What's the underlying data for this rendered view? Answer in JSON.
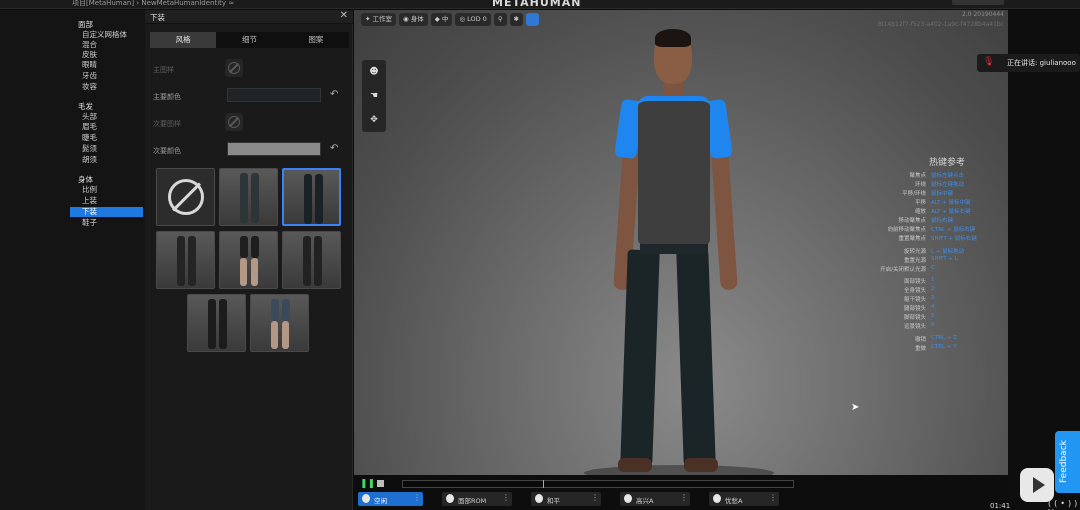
{
  "titlebar": {
    "project_path": "项目[MetaHuman] › NewMetaHumanIdentity ≈",
    "logo": "METAHUMAN"
  },
  "categories": [
    {
      "group": "面部",
      "items": [
        "自定义网格体",
        "混合",
        "皮肤",
        "眼睛",
        "牙齿",
        "妆容"
      ]
    },
    {
      "group": "毛发",
      "items": [
        "头部",
        "眉毛",
        "睫毛",
        "髭须",
        "胡须"
      ]
    },
    {
      "group": "身体",
      "items": [
        "比例",
        "上装",
        "下装",
        "鞋子"
      ],
      "selected": "下装"
    }
  ],
  "editor": {
    "title": "下装",
    "close_icon": "✕",
    "tabs": [
      "风格",
      "细节",
      "图案"
    ],
    "active_tab": "风格",
    "props": {
      "primary_pattern": "主图样",
      "primary_color_label": "主要颜色",
      "secondary_pattern": "次要图样",
      "secondary_color_label": "次要颜色"
    },
    "colors": {
      "primary": "#1e2428",
      "secondary": "#8a8a8a",
      "accent": "#1e7ae0"
    },
    "reset_icon": "↶"
  },
  "viewport": {
    "toolbar": [
      "工作室",
      "身体",
      "中",
      "LOD 0"
    ],
    "version_line1": "2.0 20190444",
    "version_line2": "BI14b12f7-f523-a402-1a9c-f4728b4a41bc",
    "tool_icons": [
      "head-icon",
      "hand-icon",
      "move-icon"
    ],
    "tool_glyphs": [
      "☻",
      "☚",
      "✥"
    ],
    "hotkeys_title": "热键参考",
    "hotkeys": [
      [
        "聚焦点",
        "鼠标左键点击"
      ],
      [
        "环绕",
        "鼠标左键拖动"
      ],
      [
        "平移/环绕",
        "鼠标中键"
      ],
      [
        "平移",
        "ALT + 鼠标中键"
      ],
      [
        "缩放",
        "ALT + 鼠标右键"
      ],
      [
        "移动聚焦点",
        "鼠标右键"
      ],
      [
        "向前移动聚焦点",
        "CTRL + 鼠标右键"
      ],
      [
        "重置聚焦点",
        "SHIFT + 鼠标右键"
      ],
      [
        "旋转光源",
        "L + 鼠标拖动"
      ],
      [
        "重置光源",
        "SHIFT + L"
      ],
      [
        "开启/关闭默认光源",
        "C"
      ],
      [
        "面部镜头",
        "1"
      ],
      [
        "全身镜头",
        "2"
      ],
      [
        "躯干镜头",
        "3"
      ],
      [
        "腿部镜头",
        "4"
      ],
      [
        "脚部镜头",
        "5"
      ],
      [
        "远景镜头",
        "6"
      ],
      [
        "撤销",
        "CTRL + Z"
      ],
      [
        "重做",
        "CTRL + Y"
      ]
    ]
  },
  "sidebar_right": {
    "speaker_text": "正在讲话: giulianooo",
    "feedback_label": "Feedback"
  },
  "playback": {
    "play_glyph": "▶",
    "animations": [
      "空闲",
      "面部ROM",
      "和平",
      "高兴A",
      "忧愁A"
    ],
    "selected": "空闲",
    "more_glyph": "⋮"
  },
  "status": {
    "clock": "01:41",
    "icons": "((•)) ⛶"
  }
}
